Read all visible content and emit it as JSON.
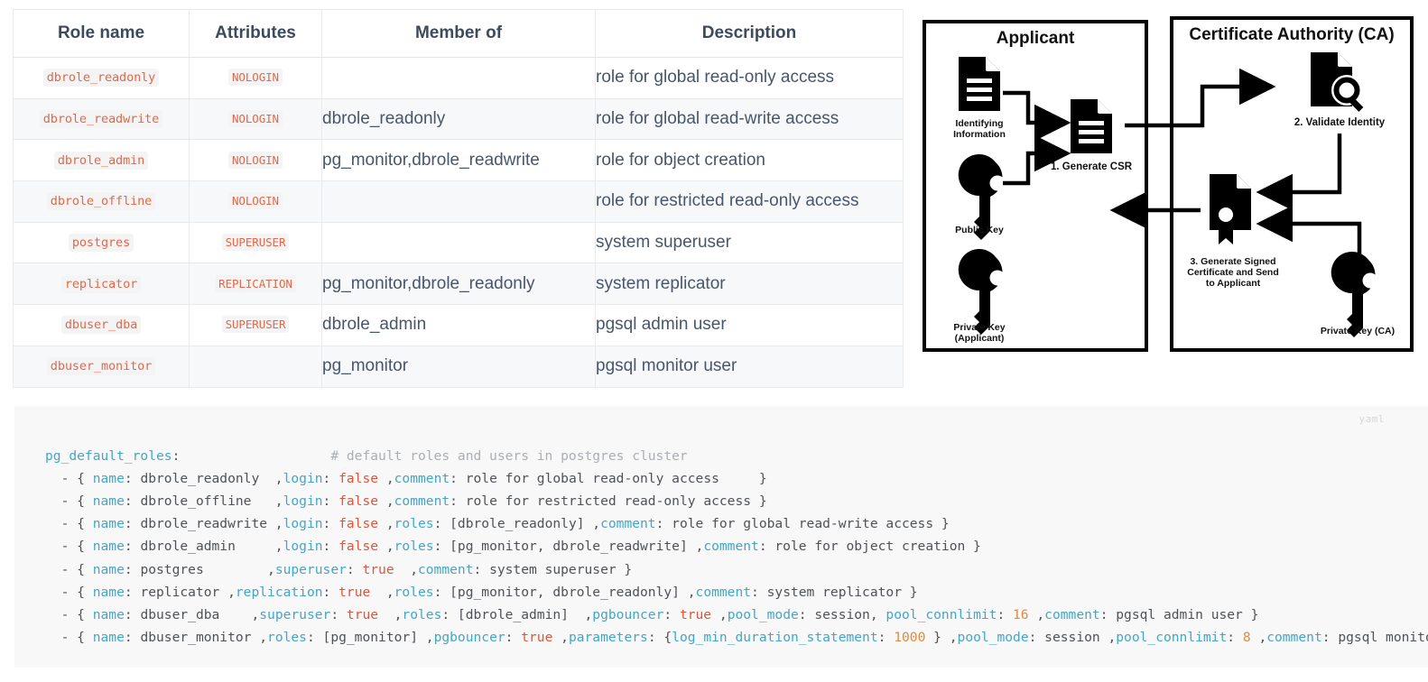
{
  "roles_table": {
    "headers": [
      "Role name",
      "Attributes",
      "Member of",
      "Description"
    ],
    "rows": [
      {
        "role": "dbrole_readonly",
        "attributes": "NOLOGIN",
        "member_of": "",
        "description": "role for global read-only access"
      },
      {
        "role": "dbrole_readwrite",
        "attributes": "NOLOGIN",
        "member_of": "dbrole_readonly",
        "description": "role for global read-write access"
      },
      {
        "role": "dbrole_admin",
        "attributes": "NOLOGIN",
        "member_of": "pg_monitor,dbrole_readwrite",
        "description": "role for object creation"
      },
      {
        "role": "dbrole_offline",
        "attributes": "NOLOGIN",
        "member_of": "",
        "description": "role for restricted read-only access"
      },
      {
        "role": "postgres",
        "attributes": "SUPERUSER",
        "member_of": "",
        "description": "system superuser"
      },
      {
        "role": "replicator",
        "attributes": "REPLICATION",
        "member_of": "pg_monitor,dbrole_readonly",
        "description": "system replicator"
      },
      {
        "role": "dbuser_dba",
        "attributes": "SUPERUSER",
        "member_of": "dbrole_admin",
        "description": "pgsql admin user"
      },
      {
        "role": "dbuser_monitor",
        "attributes": "",
        "member_of": "pg_monitor",
        "description": "pgsql monitor user"
      }
    ]
  },
  "diagram": {
    "applicant_panel": {
      "title": "Applicant",
      "labels": {
        "identifying_information": "Identifying\nInformation",
        "public_key": "Public Key",
        "private_key": "Private Key\n(Applicant)",
        "step1": "1. Generate CSR"
      }
    },
    "ca_panel": {
      "title": "Certificate Authority (CA)",
      "labels": {
        "step2": "2. Validate Identity",
        "step3": "3. Generate Signed\nCertificate and Send\nto Applicant",
        "private_key_ca": "Private Key (CA)"
      }
    }
  },
  "code_block": {
    "language": "yaml",
    "lines": [
      [
        {
          "t": "pg_default_roles",
          "c": "key"
        },
        {
          "t": ":                   ",
          "c": "pln"
        },
        {
          "t": "# default roles and users in postgres cluster",
          "c": "cmt"
        }
      ],
      [
        {
          "t": "  - { ",
          "c": "pln"
        },
        {
          "t": "name",
          "c": "key"
        },
        {
          "t": ": dbrole_readonly  ,",
          "c": "pln"
        },
        {
          "t": "login",
          "c": "key"
        },
        {
          "t": ": ",
          "c": "pln"
        },
        {
          "t": "false",
          "c": "bool"
        },
        {
          "t": " ,",
          "c": "pln"
        },
        {
          "t": "comment",
          "c": "key"
        },
        {
          "t": ": role for global read-only access     }",
          "c": "pln"
        }
      ],
      [
        {
          "t": "  - { ",
          "c": "pln"
        },
        {
          "t": "name",
          "c": "key"
        },
        {
          "t": ": dbrole_offline   ,",
          "c": "pln"
        },
        {
          "t": "login",
          "c": "key"
        },
        {
          "t": ": ",
          "c": "pln"
        },
        {
          "t": "false",
          "c": "bool"
        },
        {
          "t": " ,",
          "c": "pln"
        },
        {
          "t": "comment",
          "c": "key"
        },
        {
          "t": ": role for restricted read-only access }",
          "c": "pln"
        }
      ],
      [
        {
          "t": "  - { ",
          "c": "pln"
        },
        {
          "t": "name",
          "c": "key"
        },
        {
          "t": ": dbrole_readwrite ,",
          "c": "pln"
        },
        {
          "t": "login",
          "c": "key"
        },
        {
          "t": ": ",
          "c": "pln"
        },
        {
          "t": "false",
          "c": "bool"
        },
        {
          "t": " ,",
          "c": "pln"
        },
        {
          "t": "roles",
          "c": "key"
        },
        {
          "t": ": [dbrole_readonly] ,",
          "c": "pln"
        },
        {
          "t": "comment",
          "c": "key"
        },
        {
          "t": ": role for global read-write access }",
          "c": "pln"
        }
      ],
      [
        {
          "t": "  - { ",
          "c": "pln"
        },
        {
          "t": "name",
          "c": "key"
        },
        {
          "t": ": dbrole_admin     ,",
          "c": "pln"
        },
        {
          "t": "login",
          "c": "key"
        },
        {
          "t": ": ",
          "c": "pln"
        },
        {
          "t": "false",
          "c": "bool"
        },
        {
          "t": " ,",
          "c": "pln"
        },
        {
          "t": "roles",
          "c": "key"
        },
        {
          "t": ": [pg_monitor, dbrole_readwrite] ,",
          "c": "pln"
        },
        {
          "t": "comment",
          "c": "key"
        },
        {
          "t": ": role for object creation }",
          "c": "pln"
        }
      ],
      [
        {
          "t": "  - { ",
          "c": "pln"
        },
        {
          "t": "name",
          "c": "key"
        },
        {
          "t": ": postgres        ,",
          "c": "pln"
        },
        {
          "t": "superuser",
          "c": "key"
        },
        {
          "t": ": ",
          "c": "pln"
        },
        {
          "t": "true",
          "c": "bool"
        },
        {
          "t": "  ,",
          "c": "pln"
        },
        {
          "t": "comment",
          "c": "key"
        },
        {
          "t": ": system superuser }",
          "c": "pln"
        }
      ],
      [
        {
          "t": "  - { ",
          "c": "pln"
        },
        {
          "t": "name",
          "c": "key"
        },
        {
          "t": ": replicator ,",
          "c": "pln"
        },
        {
          "t": "replication",
          "c": "key"
        },
        {
          "t": ": ",
          "c": "pln"
        },
        {
          "t": "true",
          "c": "bool"
        },
        {
          "t": "  ,",
          "c": "pln"
        },
        {
          "t": "roles",
          "c": "key"
        },
        {
          "t": ": [pg_monitor, dbrole_readonly] ,",
          "c": "pln"
        },
        {
          "t": "comment",
          "c": "key"
        },
        {
          "t": ": system replicator }",
          "c": "pln"
        }
      ],
      [
        {
          "t": "  - { ",
          "c": "pln"
        },
        {
          "t": "name",
          "c": "key"
        },
        {
          "t": ": dbuser_dba    ,",
          "c": "pln"
        },
        {
          "t": "superuser",
          "c": "key"
        },
        {
          "t": ": ",
          "c": "pln"
        },
        {
          "t": "true",
          "c": "bool"
        },
        {
          "t": "  ,",
          "c": "pln"
        },
        {
          "t": "roles",
          "c": "key"
        },
        {
          "t": ": [dbrole_admin]  ,",
          "c": "pln"
        },
        {
          "t": "pgbouncer",
          "c": "key"
        },
        {
          "t": ": ",
          "c": "pln"
        },
        {
          "t": "true",
          "c": "bool"
        },
        {
          "t": " ,",
          "c": "pln"
        },
        {
          "t": "pool_mode",
          "c": "key"
        },
        {
          "t": ": session, ",
          "c": "pln"
        },
        {
          "t": "pool_connlimit",
          "c": "key"
        },
        {
          "t": ": ",
          "c": "pln"
        },
        {
          "t": "16",
          "c": "num"
        },
        {
          "t": " ,",
          "c": "pln"
        },
        {
          "t": "comment",
          "c": "key"
        },
        {
          "t": ": pgsql admin user }",
          "c": "pln"
        }
      ],
      [
        {
          "t": "  - { ",
          "c": "pln"
        },
        {
          "t": "name",
          "c": "key"
        },
        {
          "t": ": dbuser_monitor ,",
          "c": "pln"
        },
        {
          "t": "roles",
          "c": "key"
        },
        {
          "t": ": [pg_monitor] ,",
          "c": "pln"
        },
        {
          "t": "pgbouncer",
          "c": "key"
        },
        {
          "t": ": ",
          "c": "pln"
        },
        {
          "t": "true",
          "c": "bool"
        },
        {
          "t": " ,",
          "c": "pln"
        },
        {
          "t": "parameters",
          "c": "key"
        },
        {
          "t": ": {",
          "c": "pln"
        },
        {
          "t": "log_min_duration_statement",
          "c": "key"
        },
        {
          "t": ": ",
          "c": "pln"
        },
        {
          "t": "1000",
          "c": "num"
        },
        {
          "t": " } ,",
          "c": "pln"
        },
        {
          "t": "pool_mode",
          "c": "key"
        },
        {
          "t": ": session ,",
          "c": "pln"
        },
        {
          "t": "pool_connlimit",
          "c": "key"
        },
        {
          "t": ": ",
          "c": "pln"
        },
        {
          "t": "8",
          "c": "num"
        },
        {
          "t": " ,",
          "c": "pln"
        },
        {
          "t": "comment",
          "c": "key"
        },
        {
          "t": ": pgsql monitor use",
          "c": "pln"
        }
      ]
    ]
  }
}
